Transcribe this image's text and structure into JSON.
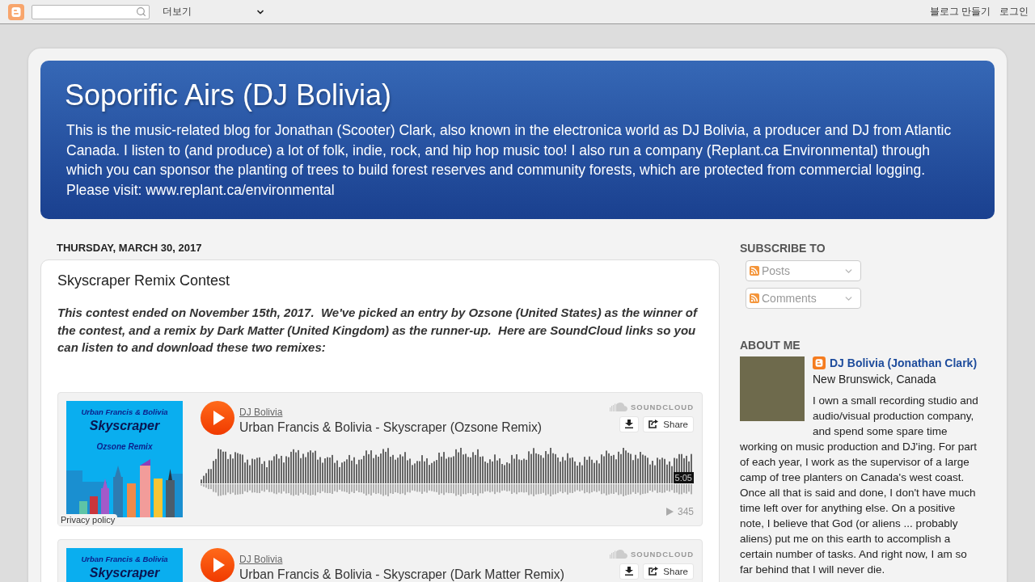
{
  "navbar": {
    "more_menu": "더보기",
    "links": [
      "블로그 만들기",
      "로그인"
    ]
  },
  "header": {
    "title": "Soporific Airs (DJ Bolivia)",
    "description": [
      "This is the music-related blog for Jonathan (Scooter) Clark, also known in the electronica world as DJ Bolivia, a producer and DJ from Atlantic Canada. I listen to (and produce) a lot of folk, indie, rock, and hip hop music too! I also run a company (Replant.ca Environmental) through which you can sponsor the planting of trees to build forest reserves and community forests, which are protected from commercial logging.",
      "Please visit: www.replant.ca/environmental"
    ]
  },
  "post": {
    "date": "THURSDAY, MARCH 30, 2017",
    "title": "Skyscraper Remix Contest",
    "intro": "This contest ended on November 15th, 2017.  We've picked an entry by Ozsone (United States) as the winner of the contest, and a remix by Dark Matter (United Kingdom) as the runner-up.  Here are SoundCloud links so you can listen to and download these two remixes:",
    "embeds": [
      {
        "artwork": {
          "credit": "Urban Francis & Bolivia",
          "title": "Skyscraper",
          "subtitle": "Ozsone Remix"
        },
        "artist": "DJ Bolivia",
        "track": "Urban Francis & Bolivia - Skyscraper (Ozsone Remix)",
        "brand": "SOUNDCLOUD",
        "share": "Share",
        "duration": "5:05",
        "plays": "345",
        "privacy": "Privacy policy"
      },
      {
        "artwork": {
          "credit": "Urban Francis & Bolivia",
          "title": "Skyscraper"
        },
        "artist": "DJ Bolivia",
        "track": "Urban Francis & Bolivia - Skyscraper (Dark Matter Remix)",
        "brand": "SOUNDCLOUD",
        "share": "Share"
      }
    ]
  },
  "sidebar": {
    "subscribe": {
      "heading": "SUBSCRIBE TO",
      "feeds": [
        "Posts",
        "Comments"
      ]
    },
    "about": {
      "heading": "ABOUT ME",
      "name": "DJ Bolivia (Jonathan Clark)",
      "location": "New Brunswick, Canada",
      "bio": "I own a small recording studio and audio/visual production company, and spend some spare time working on music production and DJ'ing. For part of each year, I work as the supervisor of a large camp of tree planters on Canada's west coast. Once all that is said and done, I don't have much time left over for anything else. On a positive note, I believe that God (or aliens ... probably aliens) put me on this earth to accomplish a certain number of tasks. And right now, I am so far behind that I will never die."
    }
  }
}
